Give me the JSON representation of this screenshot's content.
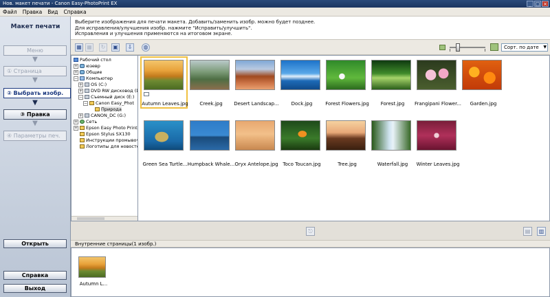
{
  "window": {
    "title": "Нов. макет печати - Canon Easy-PhotoPrint EX",
    "min": "_",
    "max": "□",
    "close": "×"
  },
  "menu": [
    "Файл",
    "Правка",
    "Вид",
    "Справка"
  ],
  "sidebar": {
    "title": "Макет печати",
    "steps": {
      "menu": "Меню",
      "page": "① Страница",
      "select": "② Выбрать изобр.",
      "edit": "③ Правка",
      "params": "④ Параметры печ."
    },
    "open_button": "Открыть",
    "help_button": "Справка",
    "exit_button": "Выход"
  },
  "instructions": [
    "Выберите изображения для печати макета. Добавить/заменить изобр. можно будет позднее.",
    "Для исправления/улучшения изобр. нажмите \"Исправить/улучшить\".",
    "Исправления и улучшения применяются на итоговом экране."
  ],
  "toolbar": {
    "sort": "Сорт. по дате"
  },
  "tree": {
    "items": [
      "Рабочий стол",
      "юзевр",
      "Общие",
      "Компьютер",
      "OS (C:)",
      "DVD RW дисковод (D",
      "Съемный диск (E:)",
      "Canon Easy_Phot",
      "Природа",
      "CANON_DC (G:)",
      "Сеть",
      "Epson Easy Photo Print",
      "Epson Stylus SX130",
      "Инструкции промывочн",
      "Логотипы для новостей"
    ]
  },
  "thumbnails": [
    {
      "caption": "Autumn Leaves.jpg"
    },
    {
      "caption": "Creek.jpg"
    },
    {
      "caption": "Desert Landscap..."
    },
    {
      "caption": "Dock.jpg"
    },
    {
      "caption": "Forest Flowers.jpg"
    },
    {
      "caption": "Forest.jpg"
    },
    {
      "caption": "Frangipani Flower..."
    },
    {
      "caption": "Garden.jpg"
    },
    {
      "caption": "Green Sea Turtle..."
    },
    {
      "caption": "Humpback Whale..."
    },
    {
      "caption": "Oryx Antelope.jpg"
    },
    {
      "caption": "Toco Toucan.jpg"
    },
    {
      "caption": "Tree.jpg"
    },
    {
      "caption": "Waterfall.jpg"
    },
    {
      "caption": "Winter Leaves.jpg"
    }
  ],
  "inner_pages": {
    "label": "Внутренние страницы(1 изобр.)",
    "caption": "Autumn L..."
  }
}
